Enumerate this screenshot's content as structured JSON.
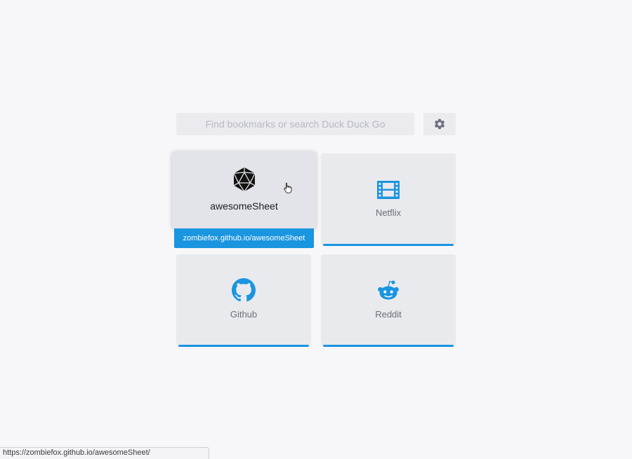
{
  "search": {
    "placeholder": "Find bookmarks or search Duck Duck Go",
    "value": ""
  },
  "settings": {
    "icon": "gear-icon"
  },
  "tiles": [
    {
      "label": "awesomeSheet",
      "icon": "d20-icon",
      "url": "zombiefox.github.io/awesomeSheet",
      "state": "hover"
    },
    {
      "label": "Netflix",
      "icon": "film-icon"
    },
    {
      "label": "Github",
      "icon": "github-icon"
    },
    {
      "label": "Reddit",
      "icon": "reddit-icon"
    }
  ],
  "status_bar": {
    "url": "https://zombiefox.github.io/awesomeSheet/"
  },
  "colors": {
    "accent": "#1a95e0",
    "tile_bg": "#e9eaee",
    "page_bg": "#f7f7f9",
    "label": "#6b6e76"
  }
}
